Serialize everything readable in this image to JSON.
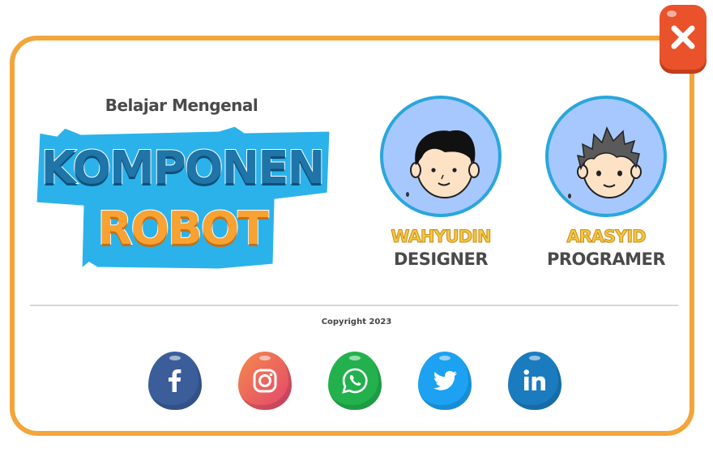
{
  "header": {
    "subtitle": "Belajar Mengenal",
    "title_line1": "KOMPONEN",
    "title_line2": "ROBOT"
  },
  "close_button": {
    "icon": "close-icon",
    "color": "#e9522a"
  },
  "team": [
    {
      "name": "WAHYUDIN",
      "role": "DESIGNER",
      "avatar": "avatar-black-hair"
    },
    {
      "name": "ARASYID",
      "role": "PROGRAMER",
      "avatar": "avatar-gray-hair"
    }
  ],
  "footer": {
    "copyright": "Copyright 2023"
  },
  "socials": [
    {
      "name": "facebook",
      "icon": "facebook-icon",
      "color": "#3b5d9a"
    },
    {
      "name": "instagram",
      "icon": "instagram-icon",
      "color": "#e9566e"
    },
    {
      "name": "whatsapp",
      "icon": "whatsapp-icon",
      "color": "#23b14d"
    },
    {
      "name": "twitter",
      "icon": "twitter-icon",
      "color": "#1da1f2"
    },
    {
      "name": "linkedin",
      "icon": "linkedin-icon",
      "color": "#1b7bbf"
    }
  ],
  "colors": {
    "frame": "#f2a53a",
    "accent_blue": "#1f74a8",
    "accent_orange": "#f7a233",
    "badge_bg": "#2bb2ea"
  }
}
